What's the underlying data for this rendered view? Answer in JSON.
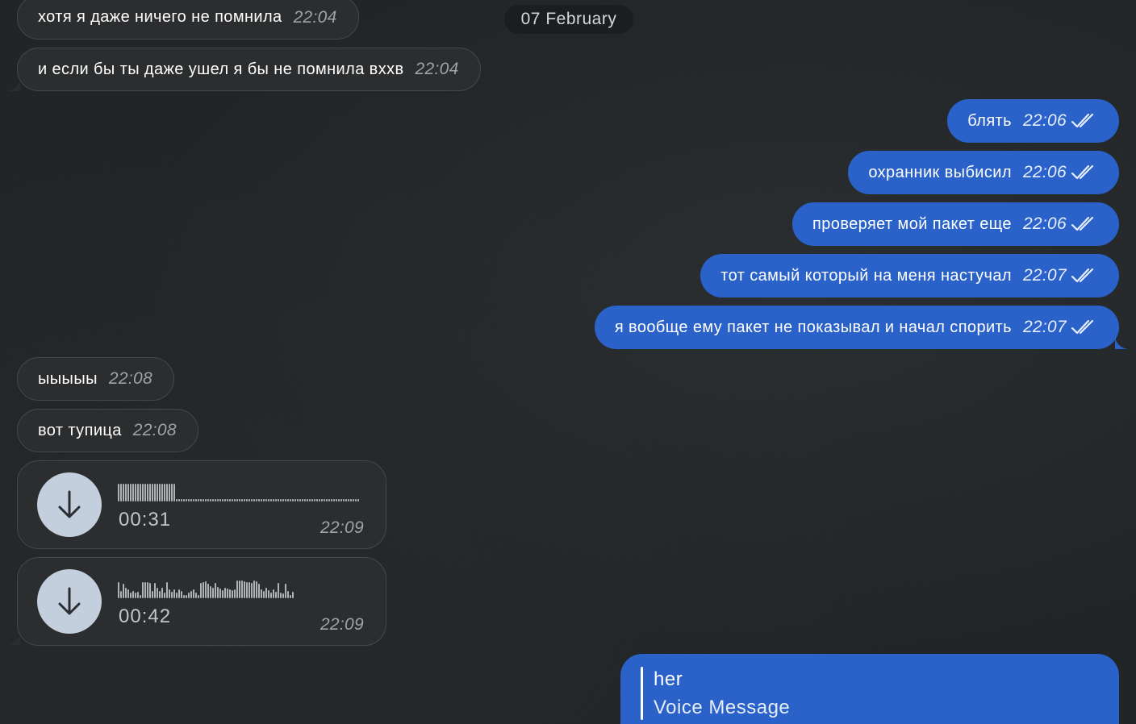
{
  "date_separator": "07 February",
  "messages": [
    {
      "dir": "in",
      "text": "хотя я даже ничего не помнила",
      "time": "22:04"
    },
    {
      "dir": "in",
      "text": "и если бы ты даже ушел я бы не помнила вххв",
      "time": "22:04"
    },
    {
      "dir": "out",
      "text": "блять",
      "time": "22:06",
      "status": "read"
    },
    {
      "dir": "out",
      "text": "охранник выбисил",
      "time": "22:06",
      "status": "read"
    },
    {
      "dir": "out",
      "text": "проверяет мой пакет еще",
      "time": "22:06",
      "status": "read"
    },
    {
      "dir": "out",
      "text": "тот самый который на меня настучал",
      "time": "22:07",
      "status": "read"
    },
    {
      "dir": "out",
      "text": "я вообще ему пакет не показывал и начал спорить",
      "time": "22:07",
      "status": "read"
    },
    {
      "dir": "in",
      "text": "ыыыыы",
      "time": "22:08"
    },
    {
      "dir": "in",
      "text": "вот тупица",
      "time": "22:08"
    }
  ],
  "voice_messages": [
    {
      "duration": "00:31",
      "time": "22:09",
      "icon": "download-arrow-icon",
      "waveform": [
        1,
        1,
        1,
        1,
        1,
        1,
        1,
        1,
        1,
        1,
        1,
        1,
        1,
        1,
        1,
        1,
        1,
        1,
        1,
        1,
        1,
        1,
        1,
        1,
        0.15,
        0.15,
        0.15,
        0.15,
        0.15,
        0.15,
        0.15,
        0.15,
        0.15,
        0.15,
        0.15,
        0.15,
        0.15,
        0.15,
        0.15,
        0.15,
        0.15,
        0.15,
        0.15,
        0.15,
        0.15,
        0.15,
        0.15,
        0.15,
        0.15,
        0.15,
        0.15,
        0.15,
        0.15,
        0.15,
        0.15,
        0.15,
        0.15,
        0.15,
        0.15,
        0.15,
        0.15,
        0.15,
        0.15,
        0.15,
        0.15,
        0.15,
        0.15,
        0.15,
        0.15,
        0.15,
        0.15,
        0.15,
        0.15,
        0.15,
        0.15,
        0.15,
        0.15,
        0.15,
        0.15,
        0.15,
        0.15,
        0.15,
        0.15,
        0.15,
        0.15,
        0.15,
        0.15,
        0.15,
        0.15,
        0.15,
        0.15,
        0.15,
        0.15,
        0.15,
        0.15,
        0.15,
        0.15,
        0.15,
        0.15,
        0.15
      ]
    },
    {
      "duration": "00:42",
      "time": "22:09",
      "icon": "download-arrow-icon",
      "waveform": [
        0.9,
        0.4,
        0.8,
        0.6,
        0.5,
        0.3,
        0.4,
        0.3,
        0.35,
        0.2,
        0.9,
        0.9,
        0.9,
        0.85,
        0.4,
        0.85,
        0.6,
        0.4,
        0.6,
        0.3,
        0.9,
        0.5,
        0.35,
        0.5,
        0.3,
        0.5,
        0.4,
        0.2,
        0.2,
        0.3,
        0.4,
        0.5,
        0.3,
        0.2,
        0.85,
        0.9,
        0.95,
        0.8,
        0.7,
        0.6,
        0.85,
        0.65,
        0.55,
        0.45,
        0.6,
        0.55,
        0.5,
        0.45,
        0.5,
        1,
        1,
        1,
        0.95,
        0.9,
        0.9,
        0.85,
        1,
        0.95,
        0.8,
        0.5,
        0.4,
        0.6,
        0.45,
        0.3,
        0.5,
        0.35,
        0.85,
        0.3,
        0.25,
        0.8,
        0.4,
        0.2,
        0.35
      ]
    }
  ],
  "reply_message": {
    "author": "her",
    "preview": "Voice Message"
  }
}
